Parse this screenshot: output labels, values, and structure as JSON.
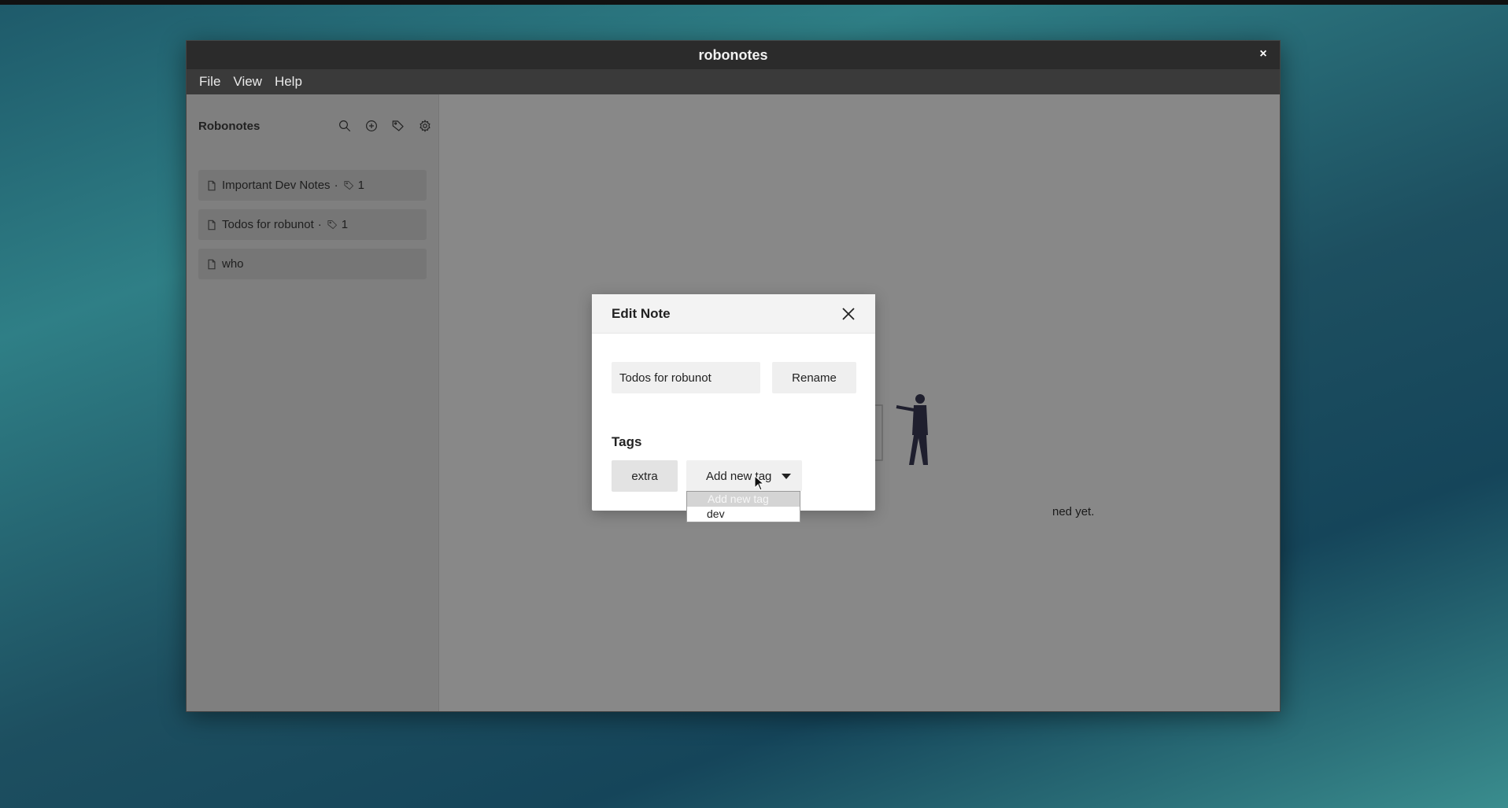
{
  "window": {
    "title": "robonotes",
    "close_glyph": "×"
  },
  "menu": {
    "items": [
      "File",
      "View",
      "Help"
    ]
  },
  "sidebar": {
    "title": "Robonotes",
    "tools": [
      "search-icon",
      "add-note-icon",
      "tag-icon",
      "gear-icon"
    ],
    "notes": [
      {
        "name": "Important Dev Notes",
        "separator": "·",
        "tag_count": "1"
      },
      {
        "name": "Todos for robunot",
        "separator": "·",
        "tag_count": "1"
      },
      {
        "name": "who"
      }
    ]
  },
  "main": {
    "empty_text": "ned yet."
  },
  "modal": {
    "title": "Edit Note",
    "rename_value": "Todos for robunot",
    "rename_label": "Rename",
    "tags_heading": "Tags",
    "tags": [
      "extra"
    ],
    "select_value": "Add new tag",
    "options": [
      "Add new tag",
      "dev"
    ]
  },
  "colors": {
    "titlebar": "#2b2b2b",
    "overlay": "#888888",
    "desktop_accent": "#2f7f86"
  }
}
